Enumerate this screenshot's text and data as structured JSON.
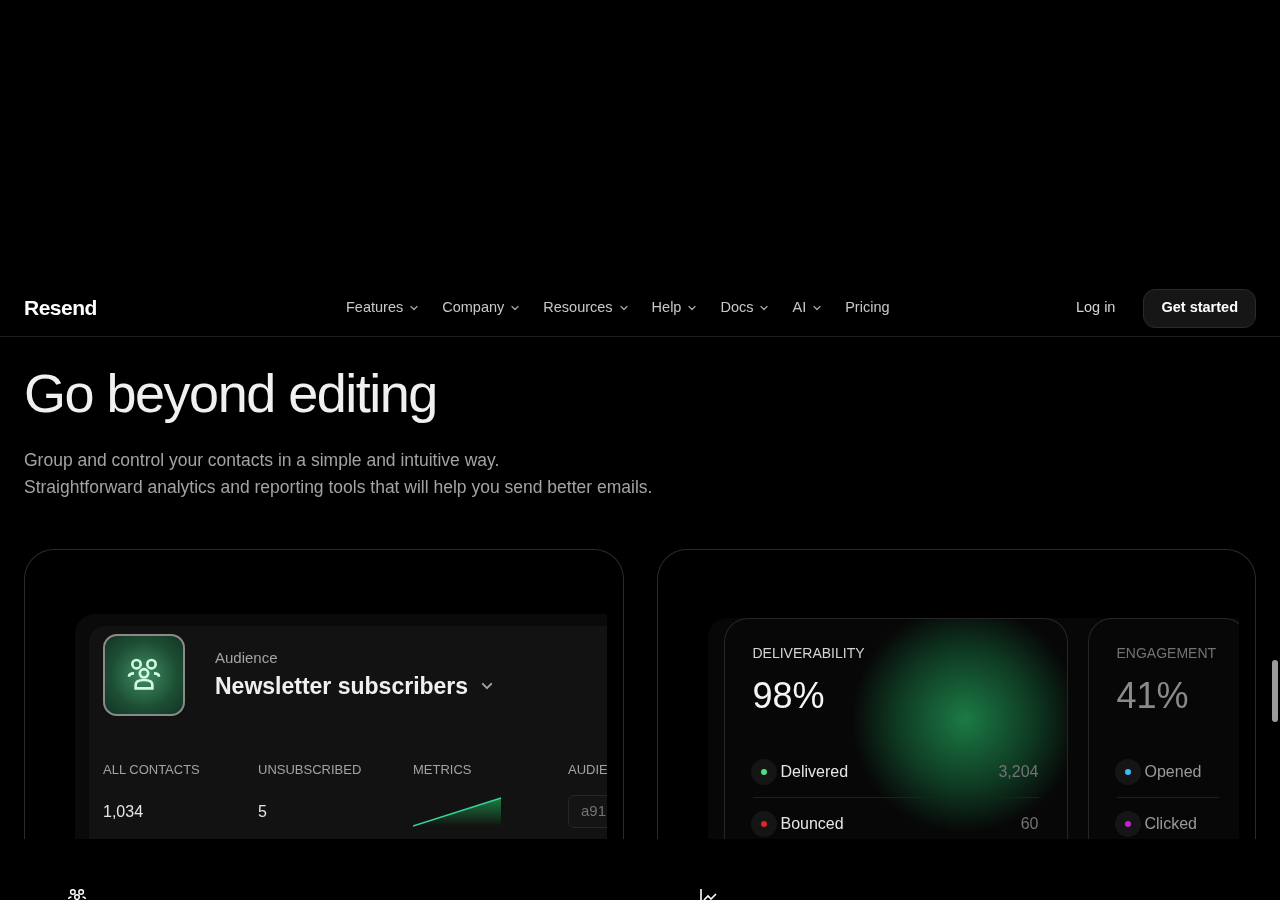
{
  "nav": {
    "logo": "Resend",
    "items": [
      {
        "label": "Features",
        "dropdown": true
      },
      {
        "label": "Company",
        "dropdown": true
      },
      {
        "label": "Resources",
        "dropdown": true
      },
      {
        "label": "Help",
        "dropdown": true
      },
      {
        "label": "Docs",
        "dropdown": true
      },
      {
        "label": "AI",
        "dropdown": true
      },
      {
        "label": "Pricing",
        "dropdown": false
      }
    ],
    "login": "Log in",
    "cta": "Get started"
  },
  "hero": {
    "title": "Go beyond editing",
    "lines": [
      "Group and control your contacts in a simple and intuitive way.",
      "Straightforward analytics and reporting tools that will help you send better emails."
    ]
  },
  "audience_card": {
    "label": "Audience",
    "name": "Newsletter subscribers",
    "stats": [
      {
        "kind": "text",
        "label": "ALL CONTACTS",
        "value": "1,034"
      },
      {
        "kind": "text",
        "label": "UNSUBSCRIBED",
        "value": "5"
      },
      {
        "kind": "sparkline",
        "label": "METRICS"
      },
      {
        "kind": "badge",
        "label": "AUDIE",
        "value": "a91"
      }
    ]
  },
  "metrics_card": {
    "panels": [
      {
        "title": "DELIVERABILITY",
        "value": "98%",
        "faded": false,
        "rows": [
          {
            "label": "Delivered",
            "count": "3,204",
            "color": "#4ade80"
          },
          {
            "label": "Bounced",
            "count": "60",
            "color": "#dc2626"
          }
        ]
      },
      {
        "title": "ENGAGEMENT",
        "value": "41%",
        "faded": true,
        "rows": [
          {
            "label": "Opened",
            "color": "#38bdf8"
          },
          {
            "label": "Clicked",
            "color": "#c026d3"
          }
        ]
      }
    ]
  }
}
